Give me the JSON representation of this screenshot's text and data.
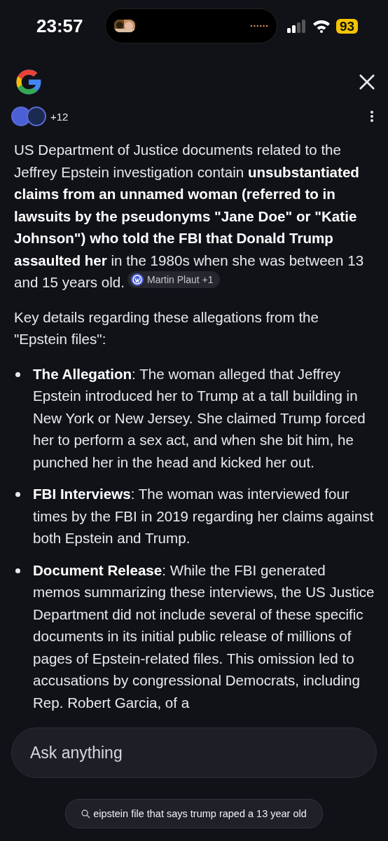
{
  "status_bar": {
    "time": "23:57",
    "battery": "93"
  },
  "sources": {
    "more": "+12"
  },
  "answer": {
    "intro": "US Department of Justice documents related to the Jeffrey Epstein investigation contain **unsubstantiated claims from an unnamed woman (referred to in lawsuits by the pseudonyms \"Jane Doe\" or \"Katie Johnson\") who told the FBI that Donald Trump assaulted her** in the 1980s when she was between 13 and 15 years old.",
    "citation": "Martin Plaut +1",
    "lead": "Key details regarding these allegations from the \"Epstein files\":",
    "bullets": [
      {
        "text": "**The Allegation**: The woman alleged that Jeffrey Epstein introduced her to Trump at a tall building in New York or New Jersey. She claimed Trump forced her to perform a sex act, and when she bit him, he punched her in the head and kicked her out."
      },
      {
        "text": "**FBI Interviews**: The woman was interviewed four times by the FBI in 2019 regarding her claims against both Epstein and Trump."
      },
      {
        "text": "**Document Release**: While the FBI generated memos summarizing these interviews, the US Justice Department did not include several of these specific documents in its initial public release of millions of pages of Epstein-related files. This omission led to accusations by congressional Democrats, including Rep. Robert Garcia, of a"
      }
    ]
  },
  "input": {
    "placeholder": "Ask anything"
  },
  "query": "eipstein file that says trump raped a 13 year old"
}
